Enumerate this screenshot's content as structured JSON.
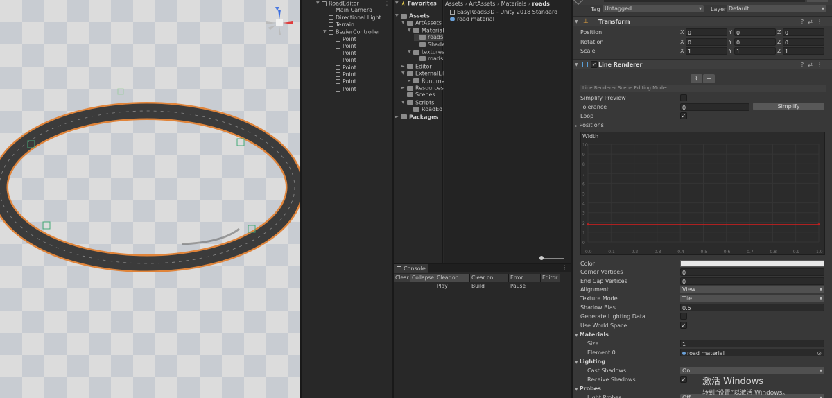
{
  "hierarchy": {
    "items": [
      {
        "label": "RoadEditor",
        "level": 0,
        "arrow": "▼",
        "type": "scene"
      },
      {
        "label": "Main Camera",
        "level": 1,
        "type": "obj"
      },
      {
        "label": "Directional Light",
        "level": 1,
        "type": "obj"
      },
      {
        "label": "Terrain",
        "level": 1,
        "type": "obj"
      },
      {
        "label": "BezierController",
        "level": 1,
        "arrow": "▼",
        "type": "obj"
      },
      {
        "label": "Point",
        "level": 2,
        "type": "obj"
      },
      {
        "label": "Point",
        "level": 2,
        "type": "obj"
      },
      {
        "label": "Point",
        "level": 2,
        "type": "obj"
      },
      {
        "label": "Point",
        "level": 2,
        "type": "obj"
      },
      {
        "label": "Point",
        "level": 2,
        "type": "obj"
      },
      {
        "label": "Point",
        "level": 2,
        "type": "obj"
      },
      {
        "label": "Point",
        "level": 2,
        "type": "obj"
      },
      {
        "label": "Point",
        "level": 2,
        "type": "obj"
      }
    ]
  },
  "project": {
    "favorites_label": "Favorites",
    "tree": [
      {
        "label": "Assets",
        "level": 0,
        "arrow": "▼",
        "bold": true
      },
      {
        "label": "ArtAssets",
        "level": 1,
        "arrow": "▼"
      },
      {
        "label": "Material",
        "level": 2,
        "arrow": "▼"
      },
      {
        "label": "roads",
        "level": 3,
        "selected": true
      },
      {
        "label": "Shaders",
        "level": 3
      },
      {
        "label": "textures",
        "level": 2,
        "arrow": "▼"
      },
      {
        "label": "roads",
        "level": 3
      },
      {
        "label": "Editor",
        "level": 1,
        "arrow": "►"
      },
      {
        "label": "ExternalLib",
        "level": 1,
        "arrow": "▼"
      },
      {
        "label": "Runtime",
        "level": 2,
        "arrow": "►"
      },
      {
        "label": "Resources",
        "level": 1,
        "arrow": "►"
      },
      {
        "label": "Scenes",
        "level": 1
      },
      {
        "label": "Scripts",
        "level": 1,
        "arrow": "▼"
      },
      {
        "label": "RoadEd",
        "level": 2
      },
      {
        "label": "Packages",
        "level": 0,
        "arrow": "►",
        "bold": true
      }
    ],
    "breadcrumb": [
      "Assets",
      "ArtAssets",
      "Materials",
      "roads"
    ],
    "files": [
      {
        "label": "EasyRoads3D - Unity 2018 Standard"
      },
      {
        "label": "road material"
      }
    ]
  },
  "console": {
    "tab_label": "Console",
    "buttons": [
      "Clear",
      "Collapse",
      "Clear on Play",
      "Clear on Build",
      "Error Pause",
      "Editor"
    ]
  },
  "inspector": {
    "tag_label": "Tag",
    "tag_value": "Untagged",
    "layer_label": "Layer",
    "layer_value": "Default",
    "transform_title": "Transform",
    "position_label": "Position",
    "rotation_label": "Rotation",
    "scale_label": "Scale",
    "pos": [
      "0",
      "0",
      "0"
    ],
    "rot": [
      "0",
      "0",
      "0"
    ],
    "scl": [
      "1",
      "1",
      "1"
    ],
    "axes": [
      "X",
      "Y",
      "Z"
    ],
    "line_renderer_title": "Line Renderer",
    "edit_mode_label": "Line Renderer Scene Editing Mode:",
    "simplify_preview_label": "Simplify Preview",
    "tolerance_label": "Tolerance",
    "tolerance_value": "0",
    "simplify_button": "Simplify",
    "loop_label": "Loop",
    "positions_label": "Positions",
    "width_label": "Width",
    "width_y_ticks": [
      "10",
      "9",
      "8",
      "7",
      "6",
      "5",
      "4",
      "3",
      "2",
      "1",
      "0"
    ],
    "width_x_ticks": [
      "0.0",
      "0.1",
      "0.2",
      "0.3",
      "0.4",
      "0.5",
      "0.6",
      "0.7",
      "0.8",
      "0.9",
      "1.0"
    ],
    "color_label": "Color",
    "corner_label": "Corner Vertices",
    "corner_value": "0",
    "endcap_label": "End Cap Vertices",
    "endcap_value": "0",
    "alignment_label": "Alignment",
    "alignment_value": "View",
    "texture_mode_label": "Texture Mode",
    "texture_mode_value": "Tile",
    "shadow_bias_label": "Shadow Bias",
    "shadow_bias_value": "0.5",
    "gen_lighting_label": "Generate Lighting Data",
    "world_space_label": "Use World Space",
    "materials_label": "Materials",
    "size_label": "Size",
    "size_value": "1",
    "element0_label": "Element 0",
    "element0_value": "road material",
    "lighting_label": "Lighting",
    "cast_shadows_label": "Cast Shadows",
    "cast_shadows_value": "On",
    "receive_shadows_label": "Receive Shadows",
    "probes_label": "Probes",
    "light_probes_label": "Light Probes",
    "light_probes_value": "Off"
  },
  "chart_data": {
    "type": "line",
    "title": "Width",
    "x": [
      0.0,
      1.0
    ],
    "series": [
      {
        "values": [
          1.8,
          1.8
        ]
      }
    ],
    "xlim": [
      0,
      1
    ],
    "ylim": [
      0,
      10
    ],
    "color": "#c02020"
  },
  "watermark": {
    "title": "激活 Windows",
    "subtitle": "转到“设置”以激活 Windows。"
  }
}
